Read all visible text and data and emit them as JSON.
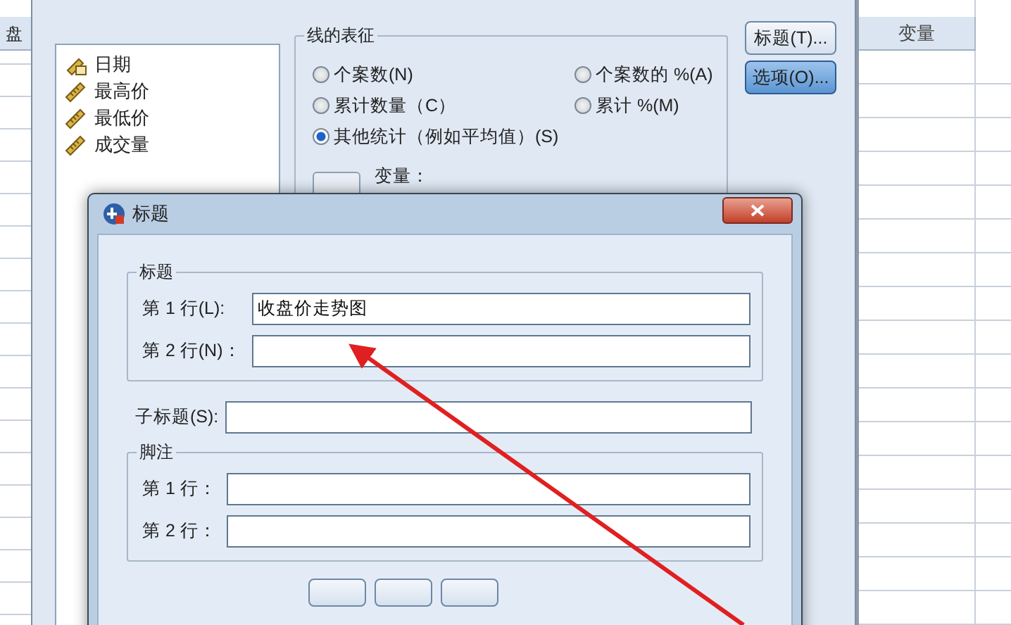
{
  "spreadsheet": {
    "left_header": "盘",
    "right_headers": [
      "变量"
    ]
  },
  "chart_dialog": {
    "variables": [
      {
        "name": "日期",
        "kind": "date"
      },
      {
        "name": "最高价",
        "kind": "scale"
      },
      {
        "name": "最低价",
        "kind": "scale"
      },
      {
        "name": "成交量",
        "kind": "scale"
      }
    ],
    "line_represents": {
      "legend": "线的表征",
      "options": [
        {
          "label": "个案数(N)",
          "selected": false
        },
        {
          "label": "个案数的 %(A)",
          "selected": false
        },
        {
          "label": "累计数量（C）",
          "selected": false
        },
        {
          "label": "累计 %(M)",
          "selected": false
        },
        {
          "label": "其他统计（例如平均值）(S)",
          "selected": true
        }
      ],
      "variable_label": "变量："
    },
    "buttons": [
      {
        "label": "标题(T)...",
        "focused": false
      },
      {
        "label": "选项(O)...",
        "focused": true
      }
    ]
  },
  "title_dialog": {
    "title": "标题",
    "title_group": {
      "legend": "标题",
      "fields": [
        {
          "label": "第 1 行(L):",
          "value": "收盘价走势图"
        },
        {
          "label": "第 2 行(N)："
        }
      ]
    },
    "subtitle": {
      "label": "子标题(S):"
    },
    "footnote_group": {
      "legend": "脚注",
      "fields": [
        {
          "label": "第 1 行："
        },
        {
          "label": "第 2 行："
        }
      ]
    }
  }
}
